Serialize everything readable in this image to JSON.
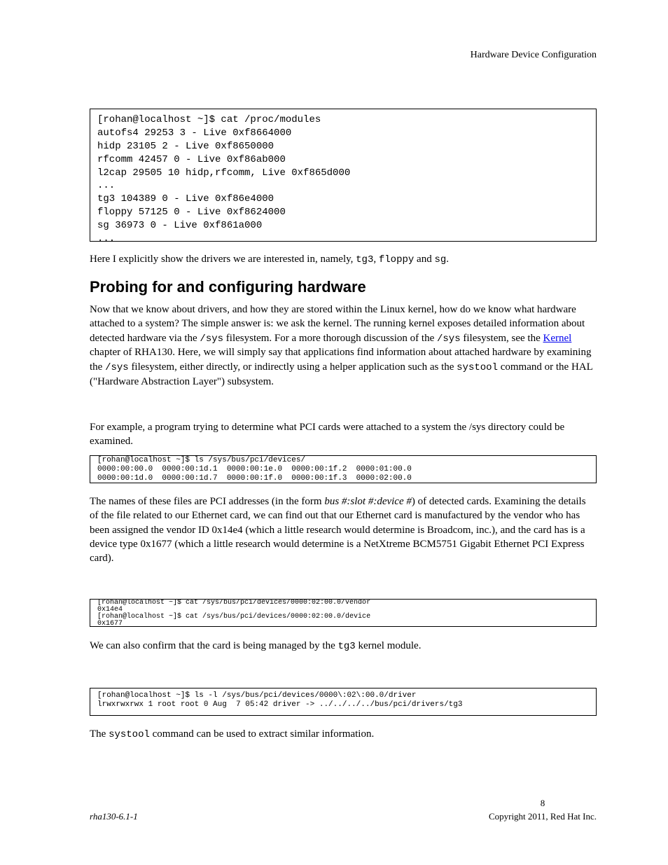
{
  "box1": {
    "lines": [
      "[rohan@localhost ~]$ cat /proc/modules",
      "autofs4 29253 3 - Live 0xf8664000",
      "hidp 23105 2 - Live 0xf8650000",
      "rfcomm 42457 0 - Live 0xf86ab000",
      "l2cap 29505 10 hidp,rfcomm, Live 0xf865d000",
      "...",
      "tg3 104389 0 - Live 0xf86e4000",
      "floppy 57125 0 - Live 0xf8624000",
      "sg 36973 0 - Live 0xf861a000",
      "..."
    ]
  },
  "para1": {
    "text_before_link": "Here I explicitly show the drivers we are interested in, namely, ",
    "code1": "tg3",
    "text_mid1": ", ",
    "code2": "floppy",
    "text_mid2": " and ",
    "code3": "sg",
    "text_after": "."
  },
  "heading1": "Probing for and configuring hardware",
  "para2": {
    "text1": "Now that we know about drivers, and how they are stored within the Linux kernel, how do we know what hardware attached to a system? The simple answer is: we ask the kernel. The running kernel exposes detailed information about detected hardware via the ",
    "code1": "/sys",
    "text2": " filesystem. For a more thorough discussion of the ",
    "code2": "/sys",
    "text3": " filesystem, see the ",
    "link_text": "Kernel",
    "text4": " chapter of RHA130. Here, we will simply say that applications find information about attached hardware by examining the ",
    "code3": "/sys",
    "text5": " filesystem, either directly, or indirectly using a helper application such as the ",
    "code4": "systool",
    "text6": " command or the HAL (\"Hardware Abstraction Layer\") subsystem.",
    "link_href": "#"
  },
  "para3": "For example, a program trying to determine what PCI cards were attached to a system the /sys directory could be examined.",
  "box2": "[rohan@localhost ~]$ ls /sys/bus/pci/devices/\n0000:00:00.0  0000:00:1d.1  0000:00:1e.0  0000:00:1f.2  0000:01:00.0\n0000:00:1d.0  0000:00:1d.7  0000:00:1f.0  0000:00:1f.3  0000:02:00.0",
  "para4": {
    "text1": "The names of these files are PCI addresses (in the form ",
    "italic": "bus #:slot #:device #",
    "text2": ") of detected cards. Examining the details of the file related to our Ethernet card, we can find out that our Ethernet card is manufactured by the vendor who has been assigned the vendor ID 0x14e4 (which a little research would determine is Broadcom, inc.), and the card has is a device type 0x1677 (which a little research would determine is a NetXtreme BCM5751 Gigabit Ethernet PCI Express card)."
  },
  "box3": "[rohan@localhost ~]$ cat /sys/bus/pci/devices/0000:02:00.0/vendor\n0x14e4\n[rohan@localhost ~]$ cat /sys/bus/pci/devices/0000:02:00.0/device\n0x1677",
  "para5": {
    "text1": "We can also confirm that the card is being managed by the ",
    "code1": "tg3",
    "text2": " kernel module."
  },
  "box4": "[rohan@localhost ~]$ ls -l /sys/bus/pci/devices/0000\\:02\\:00.0/driver\nlrwxrwxrwx 1 root root 0 Aug  7 05:42 driver -> ../../../../bus/pci/drivers/tg3",
  "para6": {
    "text1": "The ",
    "code1": "systool",
    "text2": " command can be used to extract similar information."
  },
  "footer_left": "rha130-6.1-1",
  "footer_right_page": "8",
  "footer_right_text": "Copyright 2011, Red Hat Inc."
}
